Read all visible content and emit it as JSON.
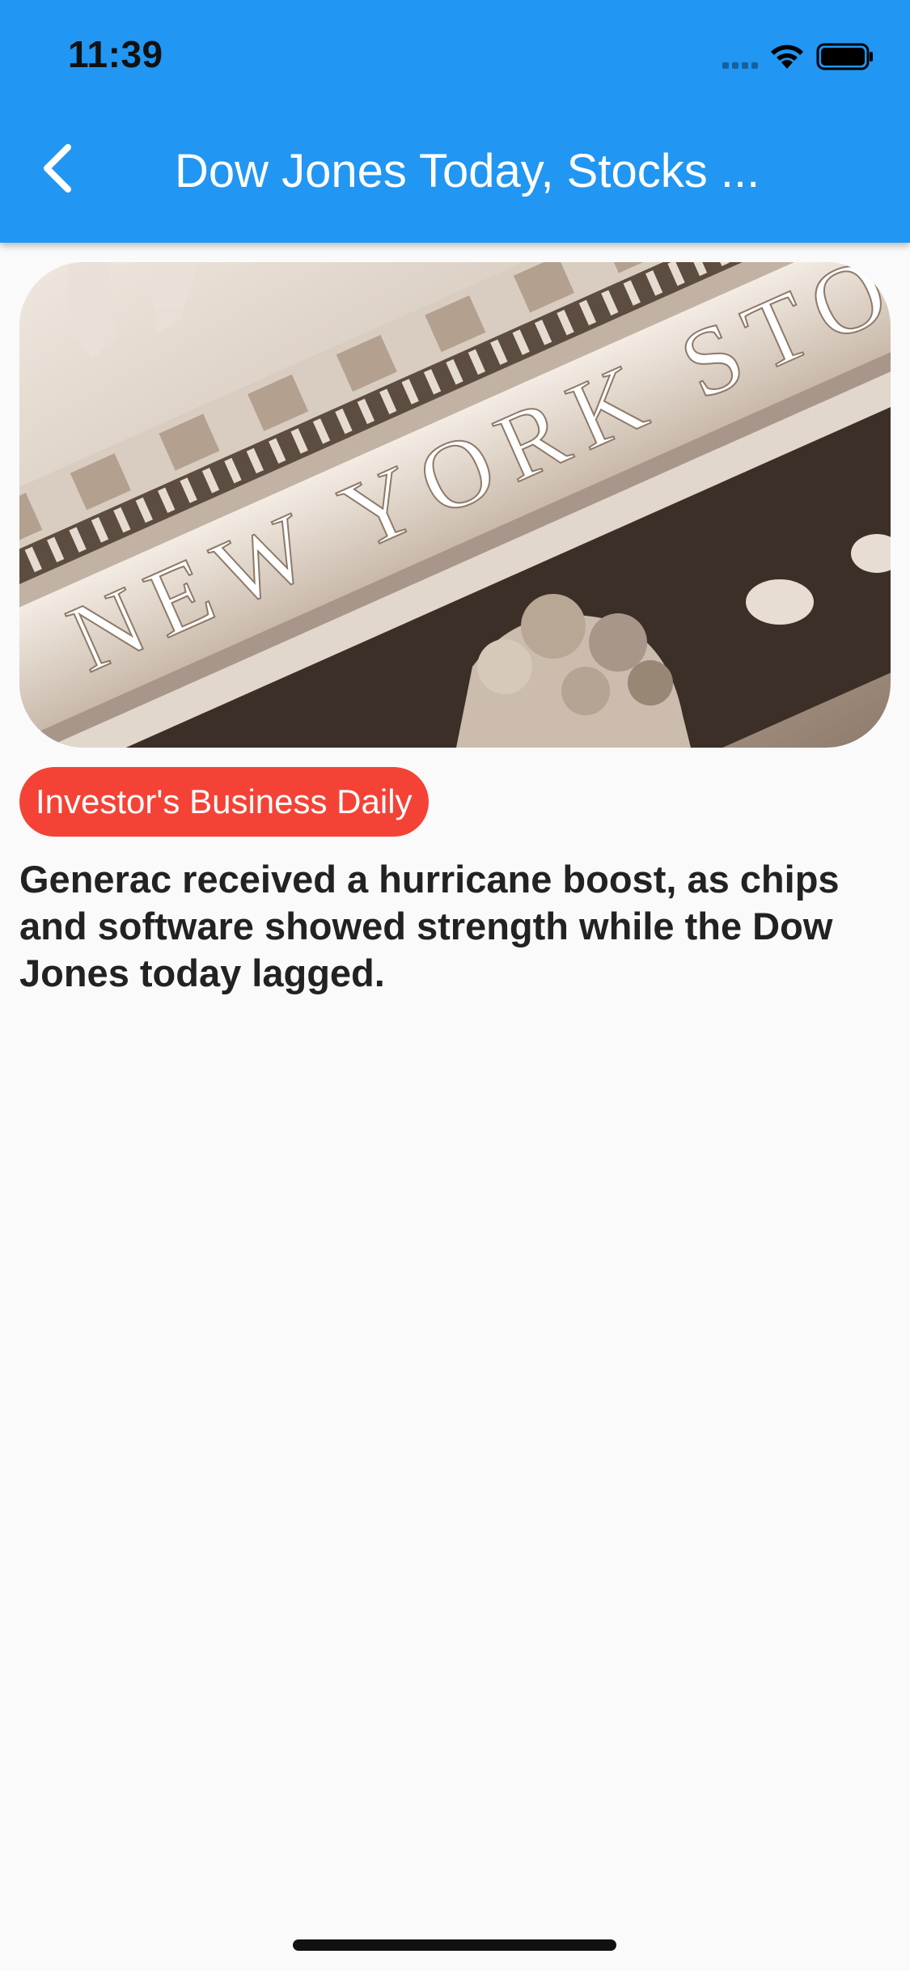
{
  "status_bar": {
    "time": "11:39",
    "icons": [
      "signal-icon",
      "wifi-icon",
      "battery-icon"
    ]
  },
  "app_bar": {
    "back_icon": "chevron-left-icon",
    "title": "Dow Jones Today, Stocks ...",
    "background_color": "#2196f3"
  },
  "article": {
    "image_text": "NEW YORK STOCK",
    "source": "Investor's Business Daily",
    "source_color": "#f44336",
    "headline": "Generac received a hurricane boost, as chips and software showed strength while the Dow Jones today lagged."
  }
}
